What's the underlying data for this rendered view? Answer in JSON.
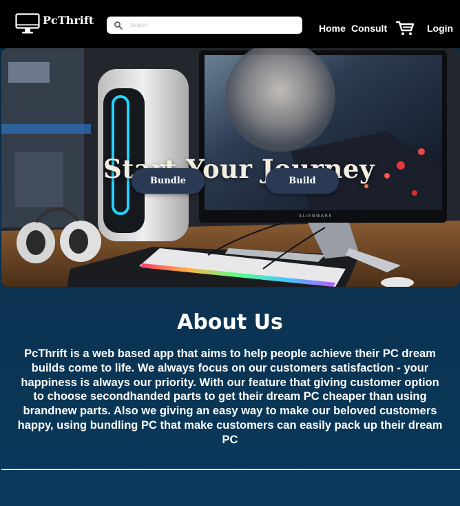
{
  "header": {
    "brand": "PcThrift",
    "logo_icon": "monitor-icon",
    "search": {
      "placeholder": "Search",
      "icon": "search-icon"
    },
    "nav": {
      "home": "Home",
      "consult": "Consult",
      "login": "Login"
    },
    "cart_icon": "shopping-cart-icon"
  },
  "hero": {
    "title": "Start Your Journey",
    "buttons": {
      "bundle": "Bundle",
      "build": "Build"
    },
    "monitor_brand": "ALIENWARE"
  },
  "about": {
    "title": "About Us",
    "text": "PcThrift is a web based app that aims to help people achieve their PC dream builds come to life.  We always focus on our customers satisfaction - your happiness is always our priority.  With our feature that giving customer option to choose secondhanded parts to get their  dream PC cheaper than using brandnew parts. Also we giving an easy way to make our beloved customers  happy, using bundling PC that make customers can easily pack up their dream PC"
  },
  "colors": {
    "navbar": "#000000",
    "page_background": "#0b3150",
    "button": "#2a3a55",
    "text": "#ffffff"
  }
}
